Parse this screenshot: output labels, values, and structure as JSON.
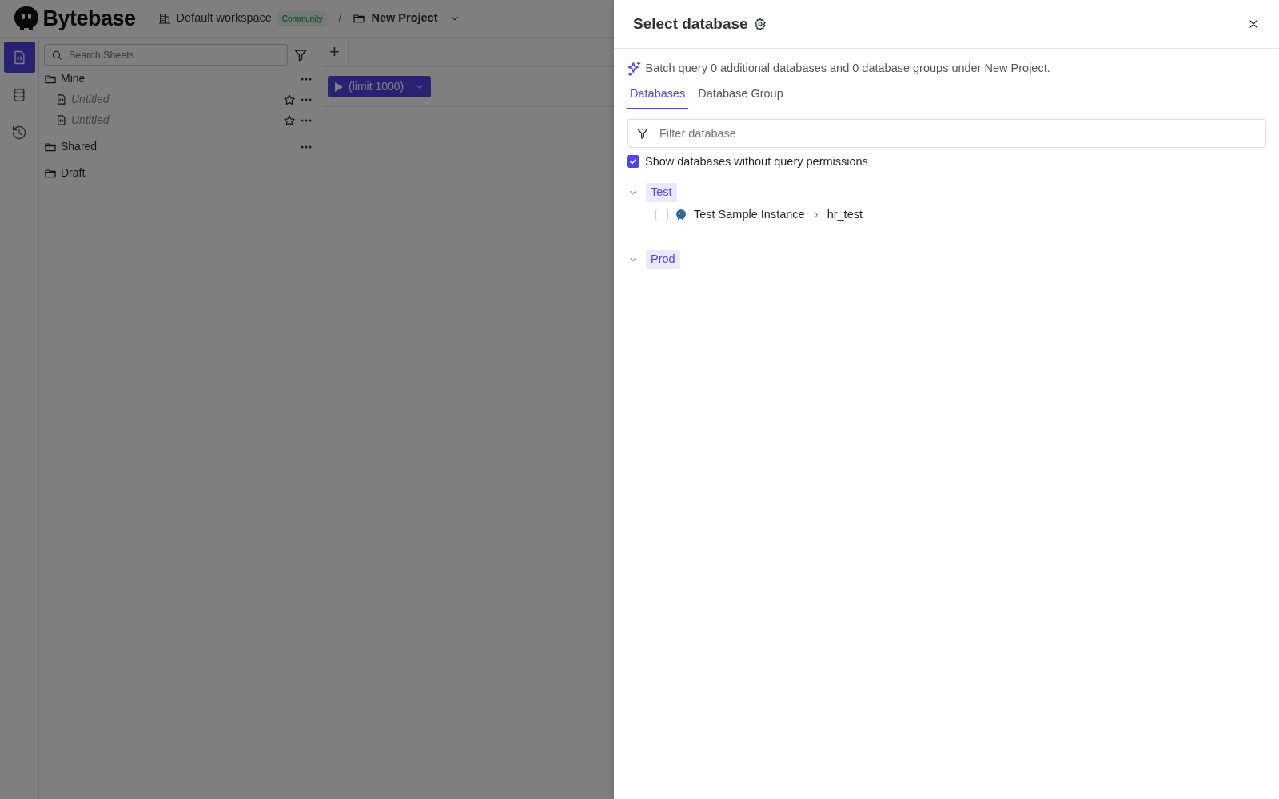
{
  "app": {
    "logo": "Bytebase",
    "workspace": "Default workspace",
    "plan_badge": "Community",
    "separator": "/",
    "project": "New Project"
  },
  "rail": [
    {
      "kind": "sheet",
      "selected": true
    },
    {
      "kind": "database",
      "selected": false
    },
    {
      "kind": "history",
      "selected": false
    }
  ],
  "sheets": {
    "search_placeholder": "Search Sheets",
    "folders": [
      {
        "label": "Mine",
        "menu": true,
        "children": [
          {
            "label": "Untitled"
          },
          {
            "label": "Untitled"
          }
        ]
      },
      {
        "label": "Shared",
        "menu": true
      },
      {
        "label": "Draft",
        "menu": false
      }
    ]
  },
  "editor": {
    "add_tab": "+",
    "run_button": "(limit 1000)"
  },
  "drawer": {
    "title": "Select database",
    "info": "Batch query 0 additional databases and 0 database groups under New Project.",
    "tabs": [
      {
        "label": "Databases",
        "selected": true
      },
      {
        "label": "Database Group",
        "selected": false
      }
    ],
    "filter": {
      "placeholder": "Filter database"
    },
    "show_without_permission": {
      "label": "Show databases without query permissions",
      "checked": true
    },
    "environments": [
      {
        "label": "Test",
        "expanded": true,
        "children": [
          {
            "instance": "Test Sample Instance",
            "database": "hr_test",
            "checked": false
          }
        ]
      },
      {
        "label": "Prod",
        "expanded": true
      }
    ]
  }
}
